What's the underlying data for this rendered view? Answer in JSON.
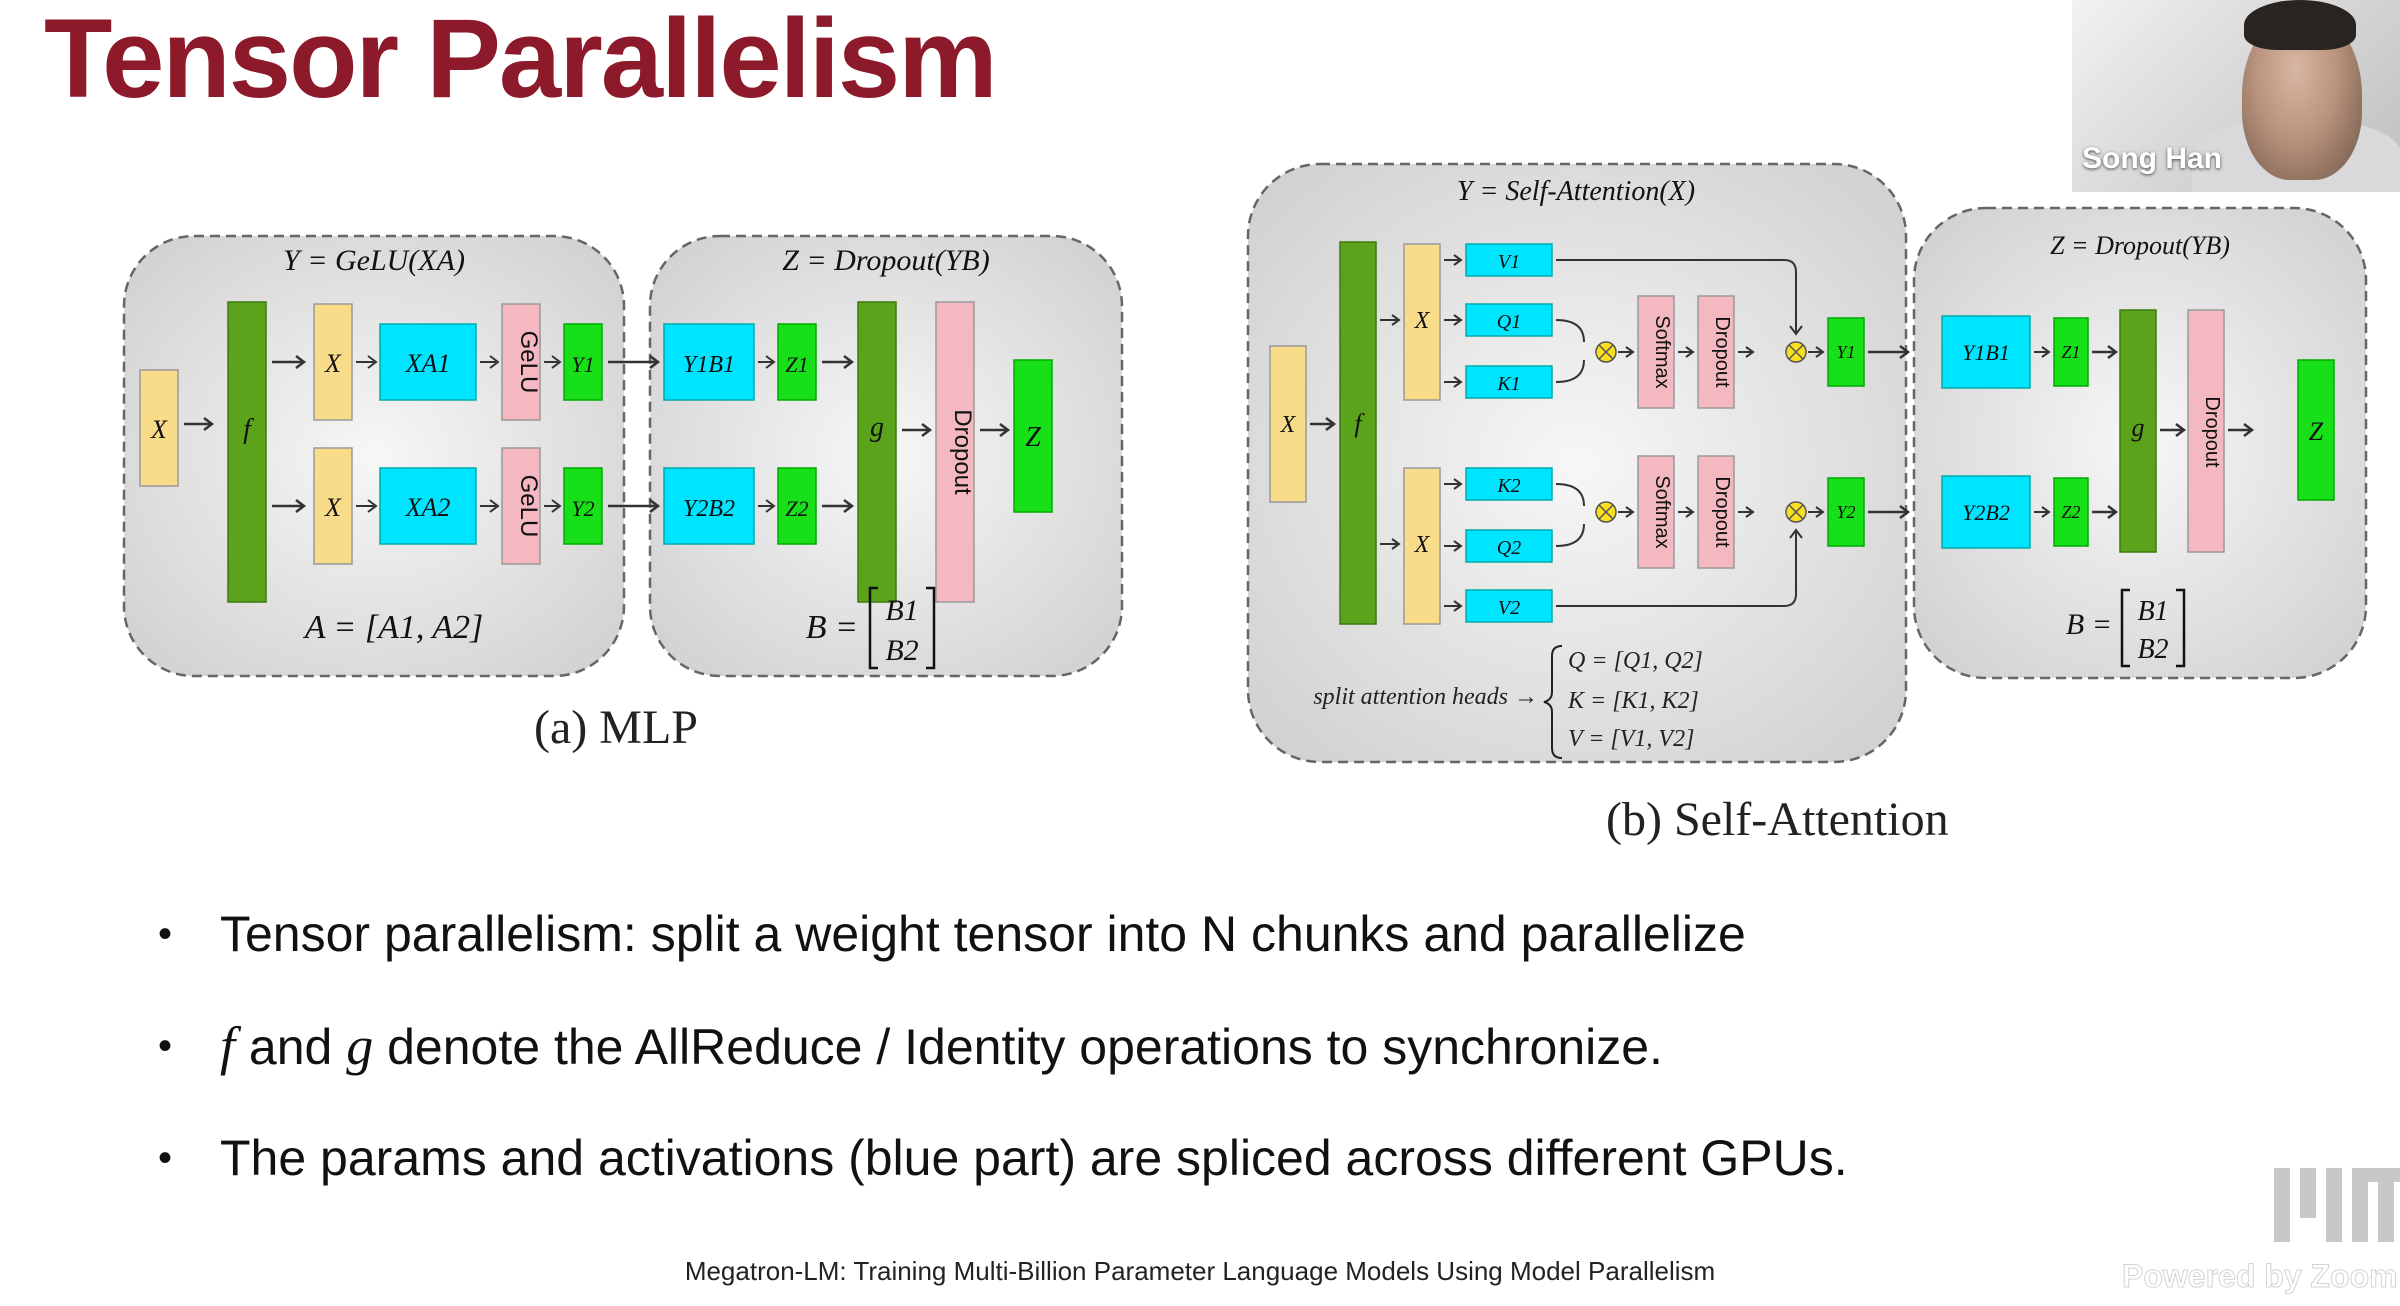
{
  "slide": {
    "title": "Tensor Parallelism",
    "bullets": [
      {
        "text": "Tensor parallelism: split a weight tensor into N chunks and parallelize"
      },
      {
        "sym1": "f",
        "mid": " and ",
        "sym2": "g",
        "text": " denote the AllReduce / Identity operations to synchronize."
      },
      {
        "text": "The params and activations (blue part) are spliced across different GPUs."
      }
    ],
    "footer": "Megatron-LM: Training Multi-Billion Parameter Language Models Using Model Parallelism"
  },
  "figure_a": {
    "caption": "(a) MLP",
    "left_box_title": "Y = GeLU(XA)",
    "right_box_title": "Z = Dropout(YB)",
    "x_in": "X",
    "f": "f",
    "g": "g",
    "top": {
      "x": "X",
      "xa": "XA1",
      "gelu": "GeLU",
      "y": "Y1",
      "yb": "Y1B1",
      "z": "Z1"
    },
    "bottom": {
      "x": "X",
      "xa": "XA2",
      "gelu": "GeLU",
      "y": "Y2",
      "yb": "Y2B2",
      "z": "Z2"
    },
    "dropout": "Dropout",
    "z_out": "Z",
    "a_eq": "A = [A1, A2]",
    "b_eq_left": "B =",
    "b_eq_top": "B1",
    "b_eq_bottom": "B2"
  },
  "figure_b": {
    "caption": "(b) Self-Attention",
    "left_box_title": "Y = Self-Attention(X)",
    "right_box_title": "Z = Dropout(YB)",
    "x_in": "X",
    "f": "f",
    "g": "g",
    "top": {
      "x": "X",
      "v": "V1",
      "q": "Q1",
      "k": "K1",
      "softmax": "Softmax",
      "dropout": "Dropout",
      "y": "Y1",
      "yb": "Y1B1",
      "z": "Z1"
    },
    "bottom": {
      "x": "X",
      "k": "K2",
      "q": "Q2",
      "v": "V2",
      "softmax": "Softmax",
      "dropout": "Dropout",
      "y": "Y2",
      "yb": "Y2B2",
      "z": "Z2"
    },
    "dropout": "Dropout",
    "z_out": "Z",
    "split_label": "split attention heads →",
    "split_q": "Q = [Q1, Q2]",
    "split_k": "K = [K1, K2]",
    "split_v": "V = [V1, V2]",
    "b_eq_left": "B =",
    "b_eq_top": "B1",
    "b_eq_bottom": "B2"
  },
  "zoom": {
    "participant_name": "Song Han",
    "watermark": "Powered by Zoom"
  },
  "colors": {
    "title": "#8c1a2a",
    "cyan": "#00e5ff",
    "green_dark": "#5aa31a",
    "green_bright": "#18e018",
    "yellow": "#f8dc8a",
    "pink": "#f4b8c0",
    "panel": "#e6e6e6"
  }
}
